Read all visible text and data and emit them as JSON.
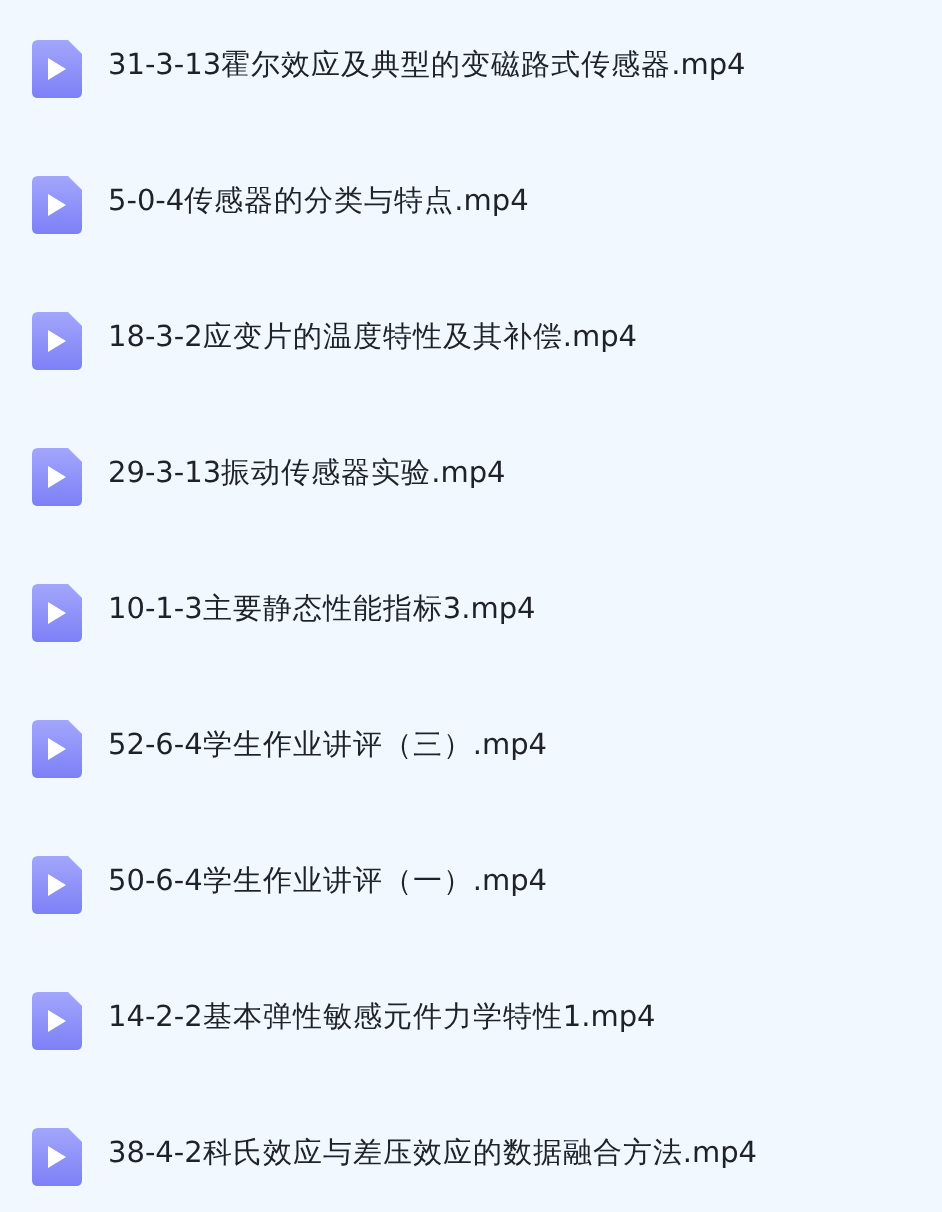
{
  "files": [
    {
      "name": "31-3-13霍尔效应及典型的变磁路式传感器.mp4"
    },
    {
      "name": "5-0-4传感器的分类与特点.mp4"
    },
    {
      "name": "18-3-2应变片的温度特性及其补偿.mp4"
    },
    {
      "name": "29-3-13振动传感器实验.mp4"
    },
    {
      "name": "10-1-3主要静态性能指标3.mp4"
    },
    {
      "name": "52-6-4学生作业讲评（三）.mp4"
    },
    {
      "name": "50-6-4学生作业讲评（一）.mp4"
    },
    {
      "name": "14-2-2基本弹性敏感元件力学特性1.mp4"
    },
    {
      "name": "38-4-2科氏效应与差压效应的数据融合方法.mp4"
    }
  ]
}
